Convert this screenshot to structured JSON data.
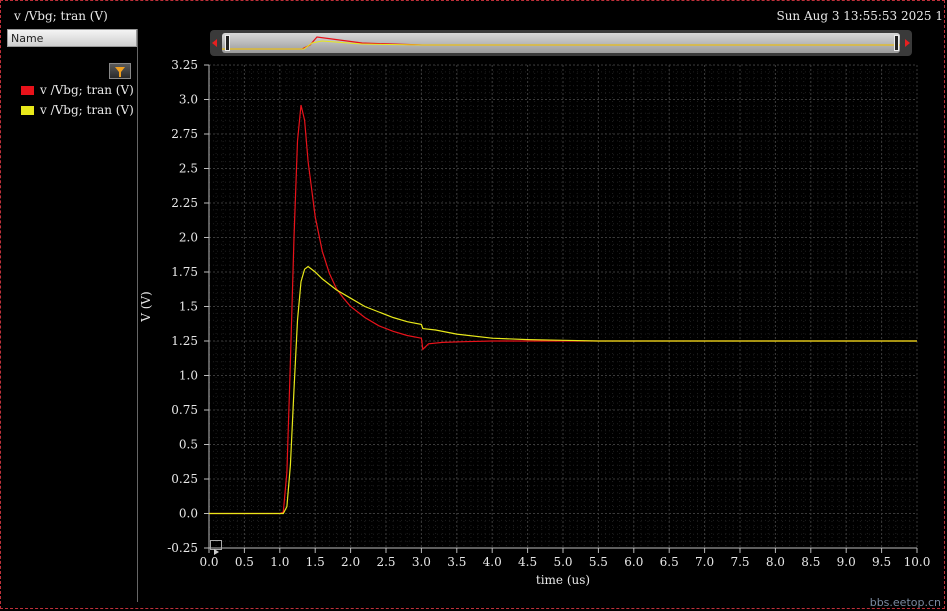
{
  "window": {
    "title": "v /Vbg; tran (V)",
    "date": "Sun Aug 3 13:55:53 2025  1",
    "watermark": "bbs.eetop.cn"
  },
  "legend": {
    "header": "Name",
    "items": [
      {
        "label": "v /Vbg; tran (V)",
        "color": "#e8121a"
      },
      {
        "label": "v /Vbg; tran (V)",
        "color": "#e8e81a"
      }
    ]
  },
  "colors": {
    "background": "#000000",
    "grid": "#3a3a3a",
    "axis": "#bbbbbb",
    "text": "#e8e8e8"
  },
  "chart_data": {
    "type": "line",
    "xlabel": "time (us)",
    "ylabel": "V (V)",
    "xlim": [
      0.0,
      10.0
    ],
    "ylim": [
      -0.25,
      3.25
    ],
    "x_ticks": [
      "0.0",
      "0.5",
      "1.0",
      "1.5",
      "2.0",
      "2.5",
      "3.0",
      "3.5",
      "4.0",
      "4.5",
      "5.0",
      "5.5",
      "6.0",
      "6.5",
      "7.0",
      "7.5",
      "8.0",
      "8.5",
      "9.0",
      "9.5",
      "10.0"
    ],
    "y_ticks": [
      "3.25",
      "3.0",
      "2.75",
      "2.5",
      "2.25",
      "2.0",
      "1.75",
      "1.5",
      "1.25",
      "1.0",
      "0.75",
      "0.5",
      "0.25",
      "0.0",
      "-0.25"
    ],
    "grid": true,
    "series": [
      {
        "name": "v /Vbg; tran (V)",
        "color": "#e8121a",
        "points": [
          [
            0,
            0
          ],
          [
            1.0,
            0
          ],
          [
            1.05,
            0.01
          ],
          [
            1.1,
            0.3
          ],
          [
            1.15,
            1.1
          ],
          [
            1.2,
            2.0
          ],
          [
            1.25,
            2.7
          ],
          [
            1.3,
            2.96
          ],
          [
            1.35,
            2.85
          ],
          [
            1.4,
            2.55
          ],
          [
            1.5,
            2.15
          ],
          [
            1.6,
            1.9
          ],
          [
            1.7,
            1.74
          ],
          [
            1.8,
            1.63
          ],
          [
            1.9,
            1.56
          ],
          [
            2.0,
            1.5
          ],
          [
            2.2,
            1.42
          ],
          [
            2.4,
            1.36
          ],
          [
            2.6,
            1.32
          ],
          [
            2.8,
            1.29
          ],
          [
            3.0,
            1.27
          ],
          [
            3.02,
            1.19
          ],
          [
            3.1,
            1.23
          ],
          [
            3.3,
            1.24
          ],
          [
            3.6,
            1.245
          ],
          [
            4.0,
            1.25
          ],
          [
            4.5,
            1.25
          ],
          [
            5.0,
            1.25
          ],
          [
            6.0,
            1.25
          ],
          [
            7.0,
            1.25
          ],
          [
            8.0,
            1.25
          ],
          [
            9.0,
            1.25
          ],
          [
            10.0,
            1.25
          ]
        ]
      },
      {
        "name": "v /Vbg; tran (V)",
        "color": "#e8e81a",
        "points": [
          [
            0,
            0
          ],
          [
            1.05,
            0
          ],
          [
            1.1,
            0.05
          ],
          [
            1.15,
            0.35
          ],
          [
            1.2,
            0.9
          ],
          [
            1.25,
            1.4
          ],
          [
            1.3,
            1.68
          ],
          [
            1.35,
            1.77
          ],
          [
            1.4,
            1.79
          ],
          [
            1.5,
            1.75
          ],
          [
            1.6,
            1.7
          ],
          [
            1.8,
            1.62
          ],
          [
            2.0,
            1.56
          ],
          [
            2.2,
            1.5
          ],
          [
            2.4,
            1.46
          ],
          [
            2.6,
            1.42
          ],
          [
            2.8,
            1.39
          ],
          [
            3.0,
            1.37
          ],
          [
            3.02,
            1.34
          ],
          [
            3.2,
            1.33
          ],
          [
            3.5,
            1.3
          ],
          [
            4.0,
            1.27
          ],
          [
            4.5,
            1.26
          ],
          [
            5.0,
            1.255
          ],
          [
            5.5,
            1.25
          ],
          [
            6.0,
            1.25
          ],
          [
            7.0,
            1.25
          ],
          [
            8.0,
            1.25
          ],
          [
            9.0,
            1.25
          ],
          [
            10.0,
            1.25
          ]
        ]
      }
    ]
  }
}
